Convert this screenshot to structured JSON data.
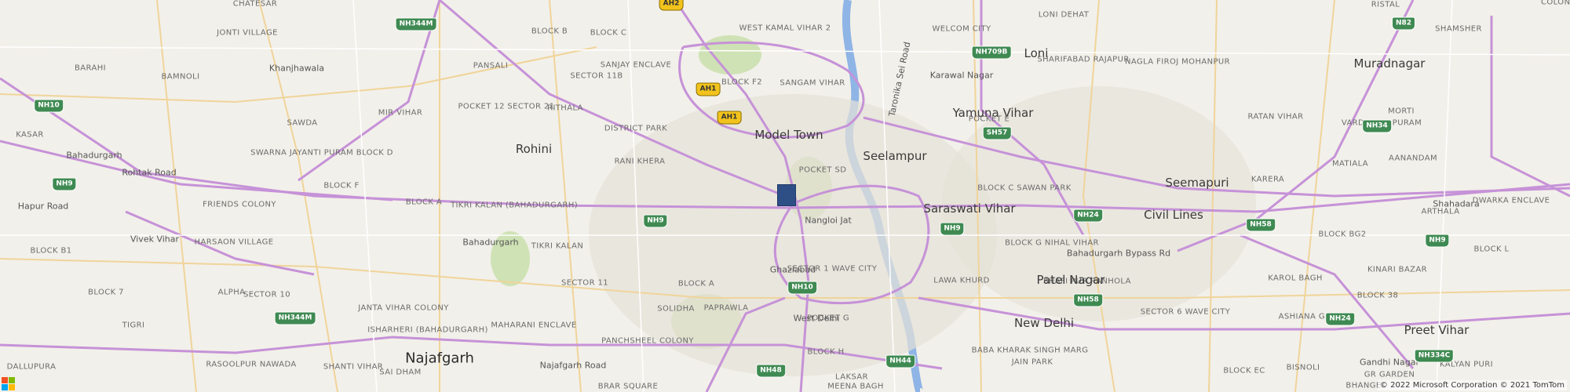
{
  "map": {
    "colors": {
      "background": "#f2f0ea",
      "major_road": "#c692d8",
      "secondary_road": "#f0d49a",
      "minor_road": "#ffffff",
      "water": "#8fb4e6",
      "park": "#cfe2b5",
      "urban": "#e5e1d7",
      "marker": "#2d4f86"
    },
    "marker": {
      "icon": "square-pin-icon"
    },
    "labels": [
      {
        "text": "CHATESAR",
        "kind": "area"
      },
      {
        "text": "JONTI VILLAGE",
        "kind": "area"
      },
      {
        "text": "BARAHI",
        "kind": "area"
      },
      {
        "text": "BAMNOLI",
        "kind": "area"
      },
      {
        "text": "Khanjhawala",
        "kind": "road"
      },
      {
        "text": "BLOCK B",
        "kind": "area"
      },
      {
        "text": "Pansali",
        "kind": "area"
      },
      {
        "text": "Block C",
        "kind": "area"
      },
      {
        "text": "Sector 11B",
        "kind": "area"
      },
      {
        "text": "Sanjay Enclave",
        "kind": "area"
      },
      {
        "text": "West Kamal Vihar 2",
        "kind": "area"
      },
      {
        "text": "Welcom City",
        "kind": "area"
      },
      {
        "text": "Loni Dehat",
        "kind": "area"
      },
      {
        "text": "Ristal",
        "kind": "area"
      },
      {
        "text": "Colony",
        "kind": "area"
      },
      {
        "text": "Shamsher",
        "kind": "area"
      },
      {
        "text": "Loni",
        "kind": "city-m"
      },
      {
        "text": "Sharifabad Rajapur",
        "kind": "area"
      },
      {
        "text": "Nagla Firoj Mohanpur",
        "kind": "area"
      },
      {
        "text": "Muradnagar",
        "kind": "city-m"
      },
      {
        "text": "Karawal Nagar",
        "kind": "road"
      },
      {
        "text": "Sangam Vihar",
        "kind": "area"
      },
      {
        "text": "Block F2",
        "kind": "area"
      },
      {
        "text": "Pocket 12 Sector 21",
        "kind": "area"
      },
      {
        "text": "Rithala",
        "kind": "area"
      },
      {
        "text": "Mir Vihar",
        "kind": "area"
      },
      {
        "text": "Sawda",
        "kind": "area"
      },
      {
        "text": "Kasar",
        "kind": "area"
      },
      {
        "text": "Bahadurgarh",
        "kind": "road"
      },
      {
        "text": "Rohtak Road",
        "kind": "road"
      },
      {
        "text": "Rohini",
        "kind": "city-m"
      },
      {
        "text": "District Park",
        "kind": "area"
      },
      {
        "text": "Model Town",
        "kind": "city-m"
      },
      {
        "text": "Seelampur",
        "kind": "city-m"
      },
      {
        "text": "Yamuna Vihar",
        "kind": "city-m"
      },
      {
        "text": "Pocket E",
        "kind": "area"
      },
      {
        "text": "Ratan Vihar",
        "kind": "area"
      },
      {
        "text": "Morti",
        "kind": "area"
      },
      {
        "text": "Vardhman Puram",
        "kind": "area"
      },
      {
        "text": "Matiala",
        "kind": "area"
      },
      {
        "text": "Aanandam",
        "kind": "area"
      },
      {
        "text": "Swarna Jayanti Puram Block D",
        "kind": "area"
      },
      {
        "text": "Rani Khera",
        "kind": "area"
      },
      {
        "text": "Pocket SD",
        "kind": "area"
      },
      {
        "text": "Block C Sawan Park",
        "kind": "area"
      },
      {
        "text": "Seemapuri",
        "kind": "city-m"
      },
      {
        "text": "Karera",
        "kind": "area"
      },
      {
        "text": "Block F",
        "kind": "area"
      },
      {
        "text": "Block A",
        "kind": "area"
      },
      {
        "text": "Friends Colony",
        "kind": "area"
      },
      {
        "text": "Tikri Kalan (Bahadurgarh)",
        "kind": "area"
      },
      {
        "text": "Nangloi Jat",
        "kind": "road"
      },
      {
        "text": "Saraswati Vihar",
        "kind": "city-m"
      },
      {
        "text": "Civil Lines",
        "kind": "city-m"
      },
      {
        "text": "Shahadara",
        "kind": "road"
      },
      {
        "text": "Dwarka Enclave",
        "kind": "area"
      },
      {
        "text": "Arthala",
        "kind": "area"
      },
      {
        "text": "Hapur Road",
        "kind": "road"
      },
      {
        "text": "Harsaon Village",
        "kind": "area"
      },
      {
        "text": "Bahadurgarh",
        "kind": "road"
      },
      {
        "text": "Tikri Kalan",
        "kind": "area"
      },
      {
        "text": "Block G Nihal Vihar",
        "kind": "area"
      },
      {
        "text": "Block BG2",
        "kind": "area"
      },
      {
        "text": "Block L",
        "kind": "area"
      },
      {
        "text": "Block B1",
        "kind": "area"
      },
      {
        "text": "Vivek Vihar",
        "kind": "road"
      },
      {
        "text": "Ghaziabad",
        "kind": "road"
      },
      {
        "text": "Sector 1 Wave City",
        "kind": "area"
      },
      {
        "text": "Lawa Khurd",
        "kind": "area"
      },
      {
        "text": "Bahadurgarh Bypass Rd",
        "kind": "road"
      },
      {
        "text": "Karol Bagh",
        "kind": "area"
      },
      {
        "text": "Kinari Bazar",
        "kind": "area"
      },
      {
        "text": "Block 7",
        "kind": "area"
      },
      {
        "text": "Sector 10",
        "kind": "area"
      },
      {
        "text": "Sector 11",
        "kind": "area"
      },
      {
        "text": "Block A",
        "kind": "area"
      },
      {
        "text": "Solidha",
        "kind": "area"
      },
      {
        "text": "Shafi Pur Ranhola",
        "kind": "area"
      },
      {
        "text": "Pocket G",
        "kind": "area"
      },
      {
        "text": "Patel Nagar",
        "kind": "city-m"
      },
      {
        "text": "Alpha",
        "kind": "area"
      },
      {
        "text": "Janta Vihar Colony",
        "kind": "area"
      },
      {
        "text": "Paprawla",
        "kind": "area"
      },
      {
        "text": "Block 38",
        "kind": "area"
      },
      {
        "text": "Sector 6 Wave City",
        "kind": "area"
      },
      {
        "text": "Ashiana Greens",
        "kind": "area"
      },
      {
        "text": "Tigri",
        "kind": "area"
      },
      {
        "text": "Isharheri (Bahadurgarh)",
        "kind": "area"
      },
      {
        "text": "Maharani Enclave",
        "kind": "area"
      },
      {
        "text": "West Delhi",
        "kind": "road"
      },
      {
        "text": "New Delhi",
        "kind": "city-m"
      },
      {
        "text": "Preet Vihar",
        "kind": "city-m"
      },
      {
        "text": "Panchsheel Colony",
        "kind": "area"
      },
      {
        "text": "Block H",
        "kind": "area"
      },
      {
        "text": "Baba Kharak Singh Marg",
        "kind": "area"
      },
      {
        "text": "Gandhi Nagar",
        "kind": "road"
      },
      {
        "text": "Rasoolpur Nawada",
        "kind": "area"
      },
      {
        "text": "Shanti Vihar",
        "kind": "area"
      },
      {
        "text": "Najafgarh",
        "kind": "city-l"
      },
      {
        "text": "Sai Dham",
        "kind": "area"
      },
      {
        "text": "Najafgarh Road",
        "kind": "road"
      },
      {
        "text": "Jain Park",
        "kind": "area"
      },
      {
        "text": "Block EC",
        "kind": "area"
      },
      {
        "text": "Kalyan Puri",
        "kind": "area"
      },
      {
        "text": "Dallupura",
        "kind": "area"
      },
      {
        "text": "Bisnoli",
        "kind": "area"
      },
      {
        "text": "Laksar",
        "kind": "area"
      },
      {
        "text": "Brar Square",
        "kind": "area"
      },
      {
        "text": "Meena Bagh",
        "kind": "area"
      },
      {
        "text": "Bhangel",
        "kind": "area"
      },
      {
        "text": "GR Garden",
        "kind": "area"
      },
      {
        "text": "Taronika Sei Road",
        "kind": "road"
      }
    ],
    "shields": [
      {
        "text": "AH2",
        "type": "ah"
      },
      {
        "text": "NH344M",
        "type": "nh"
      },
      {
        "text": "NH709B",
        "type": "nh"
      },
      {
        "text": "N82",
        "type": "nh"
      },
      {
        "text": "NH10",
        "type": "nh"
      },
      {
        "text": "AH1",
        "type": "ah"
      },
      {
        "text": "AH1",
        "type": "ah"
      },
      {
        "text": "SH57",
        "type": "nh"
      },
      {
        "text": "NH34",
        "type": "nh"
      },
      {
        "text": "NH9",
        "type": "nh"
      },
      {
        "text": "NH9",
        "type": "nh"
      },
      {
        "text": "NH9",
        "type": "nh"
      },
      {
        "text": "NH24",
        "type": "nh"
      },
      {
        "text": "NH58",
        "type": "nh"
      },
      {
        "text": "NH9",
        "type": "nh"
      },
      {
        "text": "NH10",
        "type": "nh"
      },
      {
        "text": "NH58",
        "type": "nh"
      },
      {
        "text": "NH344M",
        "type": "nh"
      },
      {
        "text": "NH24",
        "type": "nh"
      },
      {
        "text": "NH44",
        "type": "nh"
      },
      {
        "text": "NH334C",
        "type": "nh"
      },
      {
        "text": "NH48",
        "type": "nh"
      }
    ],
    "attribution": "© 2022 Microsoft Corporation © 2021 TomTom",
    "logo": {
      "name": "Microsoft Bing",
      "icon": "microsoft-logo-icon",
      "colors": [
        "#f25022",
        "#7fba00",
        "#00a4ef",
        "#ffb900"
      ]
    }
  }
}
